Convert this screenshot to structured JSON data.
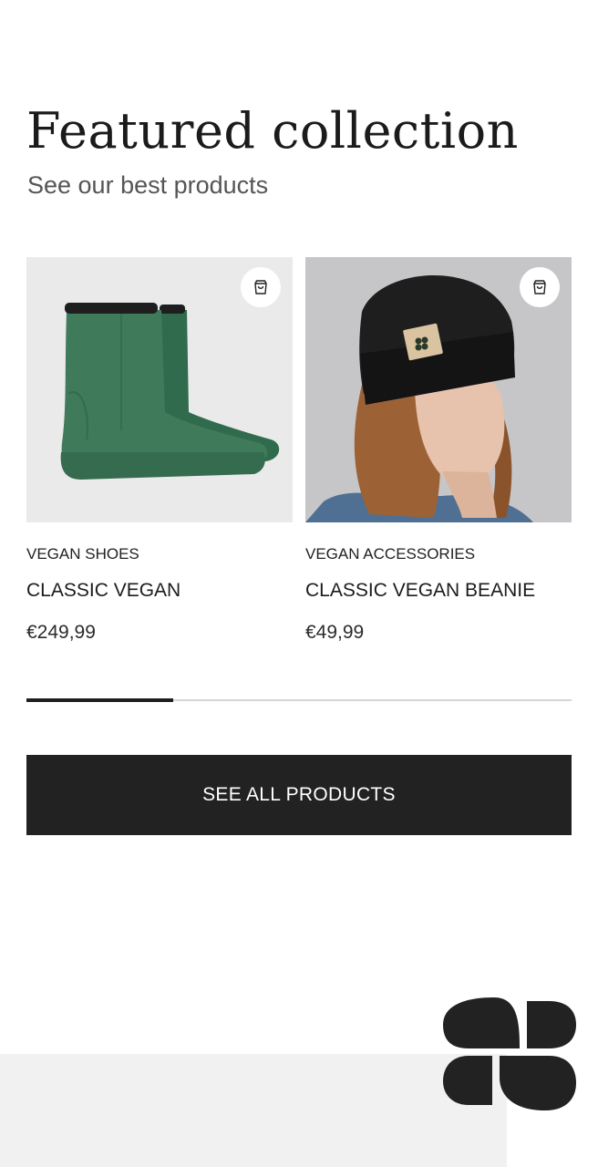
{
  "header": {
    "title": "Featured collection",
    "subtitle": "See our best products"
  },
  "products": [
    {
      "category": "VEGAN SHOES",
      "name": "CLASSIC VEGAN",
      "price": "€249,99",
      "image": "green-vegan-boots-photo",
      "cart_icon": "shopping-bag-icon"
    },
    {
      "category": "VEGAN ACCESSORIES",
      "name": "CLASSIC VEGAN BEANIE",
      "price": "€49,99",
      "image": "woman-wearing-black-beanie-photo",
      "cart_icon": "shopping-bag-icon"
    }
  ],
  "carousel": {
    "progress": 0.27
  },
  "cta": {
    "label": "SEE ALL PRODUCTS"
  },
  "brand": {
    "logo_icon": "four-petal-clover-logo",
    "colors": {
      "primary": "#222222",
      "footer_bg": "#f1f1f1",
      "boot_green": "#3f7a5a"
    }
  }
}
